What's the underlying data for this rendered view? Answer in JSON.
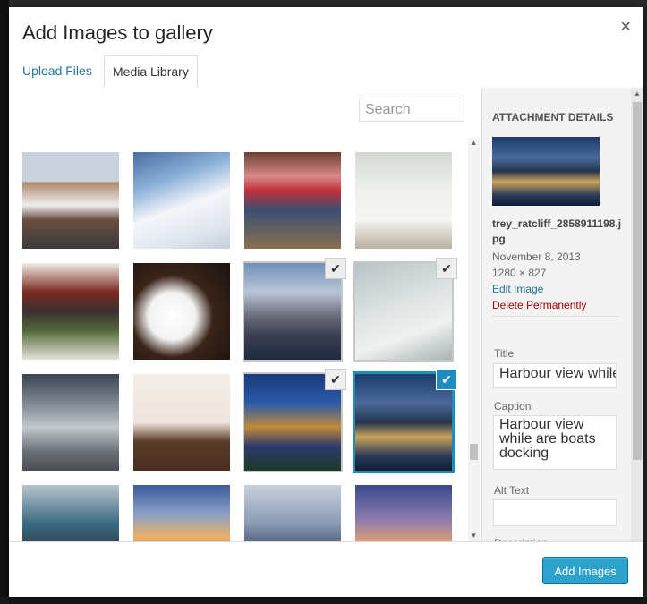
{
  "modal": {
    "title": "Add Images to gallery",
    "close_label": "×"
  },
  "tabs": [
    {
      "label": "Upload Files",
      "active": false
    },
    {
      "label": "Media Library",
      "active": true
    }
  ],
  "search": {
    "placeholder": "Search",
    "value": ""
  },
  "thumbnails": [
    {
      "name": "man-with-bicycle",
      "selected": false
    },
    {
      "name": "hikers-in-snow",
      "selected": false
    },
    {
      "name": "couple-on-bench-balloon",
      "selected": false
    },
    {
      "name": "coffee-book-headphones",
      "selected": false
    },
    {
      "name": "stack-of-books",
      "selected": false
    },
    {
      "name": "second-cup-coffee",
      "selected": false
    },
    {
      "name": "city-skyline-dusk",
      "selected": true
    },
    {
      "name": "birds-on-antenna",
      "selected": true
    },
    {
      "name": "louvre-pyramid",
      "selected": false
    },
    {
      "name": "animal-figurines",
      "selected": false
    },
    {
      "name": "hong-kong-night",
      "selected": true
    },
    {
      "name": "harbour-view",
      "selected": true,
      "focused": true
    },
    {
      "name": "bridge-light-trails",
      "selected": false
    },
    {
      "name": "sunset-sea",
      "selected": false
    },
    {
      "name": "rocky-shore",
      "selected": false
    },
    {
      "name": "pier-sunset",
      "selected": false
    }
  ],
  "check_glyph": "✔",
  "attachment": {
    "heading": "ATTACHMENT DETAILS",
    "filename": "trey_ratcliff_2858911198.jpg",
    "date": "November 8, 2013",
    "dimensions": "1280 × 827",
    "edit_label": "Edit Image",
    "delete_label": "Delete Permanently",
    "title_label": "Title",
    "title_value": "Harbour view while are boats docking",
    "caption_label": "Caption",
    "caption_value": "Harbour view while are boats docking",
    "alt_label": "Alt Text",
    "alt_value": "",
    "description_label": "Description"
  },
  "footer": {
    "add_button_label": "Add Images"
  },
  "colors": {
    "accent": "#2ea2cc",
    "link": "#21759b",
    "delete": "#aa0000",
    "selected_border": "#1e8cbe"
  }
}
